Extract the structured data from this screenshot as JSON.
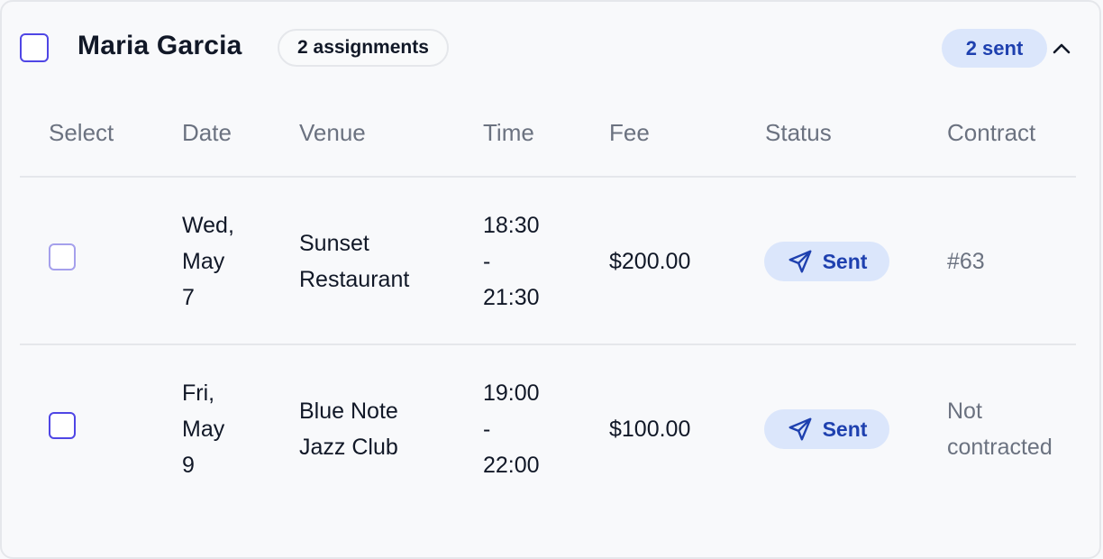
{
  "group": {
    "name": "Maria Garcia",
    "assignments_badge": "2 assignments",
    "sent_badge": "2 sent"
  },
  "columns": {
    "select": "Select",
    "date": "Date",
    "venue": "Venue",
    "time": "Time",
    "fee": "Fee",
    "status": "Status",
    "contract": "Contract"
  },
  "rows": [
    {
      "date_line1": "Wed,",
      "date_line2": "May",
      "date_line3": "7",
      "venue_line1": "Sunset",
      "venue_line2": "Restaurant",
      "time_line1": "18:30",
      "time_line2": "-",
      "time_line3": "21:30",
      "fee": "$200.00",
      "status": "Sent",
      "contract_line1": "#63",
      "contract_line2": ""
    },
    {
      "date_line1": "Fri,",
      "date_line2": "May",
      "date_line3": "9",
      "venue_line1": "Blue Note",
      "venue_line2": "Jazz Club",
      "time_line1": "19:00",
      "time_line2": "-",
      "time_line3": "22:00",
      "fee": "$100.00",
      "status": "Sent",
      "contract_line1": "Not",
      "contract_line2": "contracted"
    }
  ],
  "colors": {
    "accent": "#4f46e5",
    "badge_bg": "#dbe6fb",
    "badge_text": "#1e40af",
    "muted_text": "#6b7280"
  },
  "icons": {
    "status": "send-icon",
    "collapse": "chevron-up-icon"
  }
}
